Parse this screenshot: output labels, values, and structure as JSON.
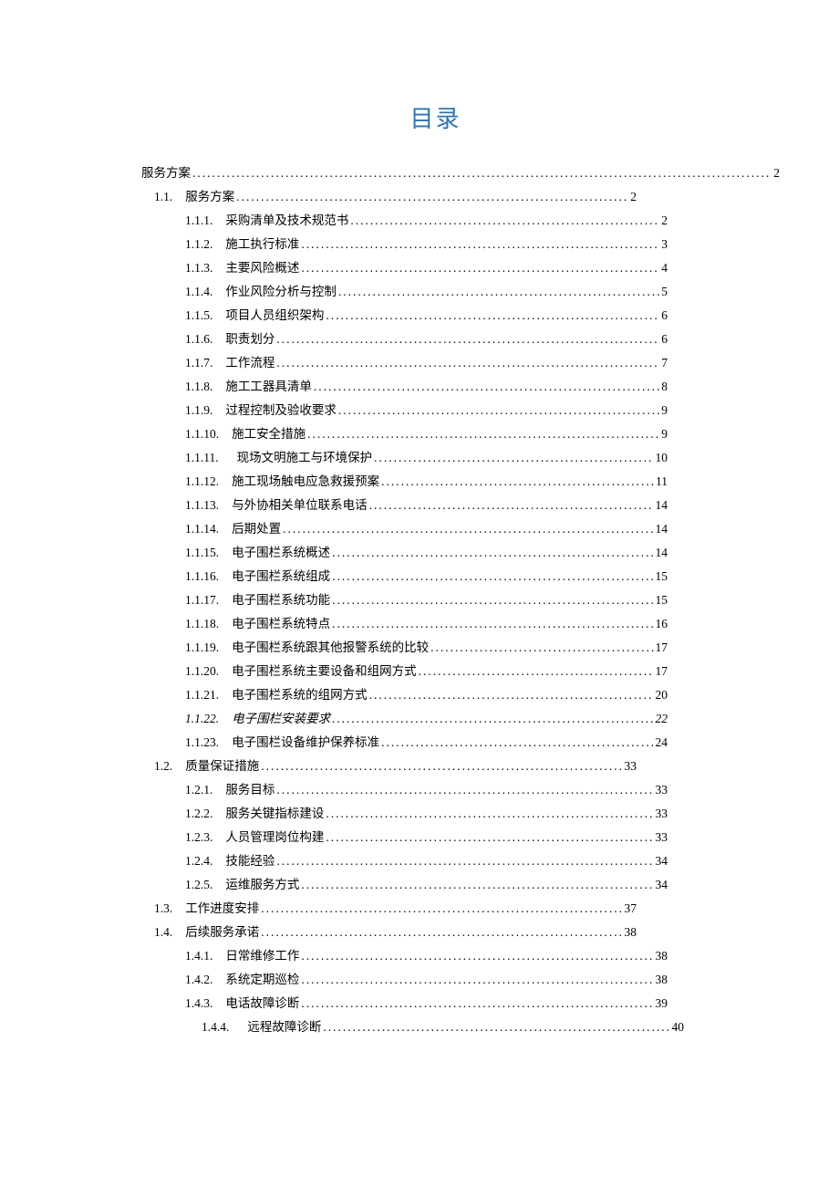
{
  "title": "目录",
  "toc": [
    {
      "indent": 0,
      "num": "",
      "text": "服务方案",
      "page": "2",
      "cls": "wide",
      "txtcls": "tight",
      "numhide": true
    },
    {
      "indent": 1,
      "num": "1.1.",
      "text": "服务方案",
      "page": "2",
      "cls": "short",
      "txtcls": ""
    },
    {
      "indent": 2,
      "num": "1.1.1.",
      "text": "采购清单及技术规范书",
      "page": "2",
      "cls": "short",
      "txtcls": ""
    },
    {
      "indent": 2,
      "num": "1.1.2.",
      "text": "施工执行标准",
      "page": "3",
      "cls": "short",
      "txtcls": ""
    },
    {
      "indent": 2,
      "num": "1.1.3.",
      "text": "主要风险概述",
      "page": "4",
      "cls": "short",
      "txtcls": ""
    },
    {
      "indent": 2,
      "num": "1.1.4.",
      "text": "作业风险分析与控制",
      "page": "5",
      "cls": "short",
      "txtcls": ""
    },
    {
      "indent": 2,
      "num": "1.1.5.",
      "text": "项目人员组织架构",
      "page": "6",
      "cls": "short",
      "txtcls": ""
    },
    {
      "indent": 2,
      "num": "1.1.6.",
      "text": "职责划分",
      "page": "6",
      "cls": "short",
      "txtcls": ""
    },
    {
      "indent": 2,
      "num": "1.1.7.",
      "text": "工作流程",
      "page": "7",
      "cls": "short",
      "txtcls": ""
    },
    {
      "indent": 2,
      "num": "1.1.8.",
      "text": "施工工器具清单",
      "page": "8",
      "cls": "short",
      "txtcls": ""
    },
    {
      "indent": 2,
      "num": "1.1.9.",
      "text": "过程控制及验收要求",
      "page": "9",
      "cls": "short",
      "txtcls": ""
    },
    {
      "indent": 2,
      "num": "1.1.10.",
      "text": "施工安全措施",
      "page": "9",
      "cls": "short",
      "txtcls": ""
    },
    {
      "indent": 2,
      "num": "1.1.11.",
      "text": "现场文明施工与环境保护",
      "page": "10",
      "cls": "short",
      "txtcls": "loose"
    },
    {
      "indent": 2,
      "num": "1.1.12.",
      "text": "施工现场触电应急救援预案",
      "page": "11",
      "cls": "short",
      "txtcls": ""
    },
    {
      "indent": 2,
      "num": "1.1.13.",
      "text": "与外协相关单位联系电话",
      "page": "14",
      "cls": "short",
      "txtcls": ""
    },
    {
      "indent": 2,
      "num": "1.1.14.",
      "text": "后期处置",
      "page": "14",
      "cls": "short",
      "txtcls": ""
    },
    {
      "indent": 2,
      "num": "1.1.15.",
      "text": "电子围栏系统概述",
      "page": "14",
      "cls": "short",
      "txtcls": ""
    },
    {
      "indent": 2,
      "num": "1.1.16.",
      "text": "电子围栏系统组成",
      "page": "15",
      "cls": "short",
      "txtcls": ""
    },
    {
      "indent": 2,
      "num": "1.1.17.",
      "text": "电子围栏系统功能",
      "page": "15",
      "cls": "short",
      "txtcls": ""
    },
    {
      "indent": 2,
      "num": "1.1.18.",
      "text": "电子围栏系统特点",
      "page": "16",
      "cls": "short",
      "txtcls": ""
    },
    {
      "indent": 2,
      "num": "1.1.19.",
      "text": "电子围栏系统跟其他报警系统的比较",
      "page": "17",
      "cls": "short",
      "txtcls": ""
    },
    {
      "indent": 2,
      "num": "1.1.20.",
      "text": "电子围栏系统主要设备和组网方式",
      "page": "17",
      "cls": "short",
      "txtcls": ""
    },
    {
      "indent": 2,
      "num": "1.1.21.",
      "text": "电子围栏系统的组网方式",
      "page": "20",
      "cls": "short",
      "txtcls": ""
    },
    {
      "indent": 2,
      "num": "1.1.22.",
      "text": "电子围栏安装要求",
      "page": "22",
      "cls": "short",
      "txtcls": "",
      "italic": true
    },
    {
      "indent": 2,
      "num": "1.1.23.",
      "text": "电子围栏设备维护保养标准",
      "page": "24",
      "cls": "short",
      "txtcls": ""
    },
    {
      "indent": 1,
      "num": "1.2.",
      "text": "质量保证措施",
      "page": "33",
      "cls": "short",
      "txtcls": ""
    },
    {
      "indent": 2,
      "num": "1.2.1.",
      "text": "服务目标",
      "page": "33",
      "cls": "short",
      "txtcls": ""
    },
    {
      "indent": 2,
      "num": "1.2.2.",
      "text": "服务关键指标建设",
      "page": "33",
      "cls": "short",
      "txtcls": ""
    },
    {
      "indent": 2,
      "num": "1.2.3.",
      "text": "人员管理岗位构建",
      "page": "33",
      "cls": "short",
      "txtcls": ""
    },
    {
      "indent": 2,
      "num": "1.2.4.",
      "text": "技能经验",
      "page": "34",
      "cls": "short",
      "txtcls": ""
    },
    {
      "indent": 2,
      "num": "1.2.5.",
      "text": "运维服务方式",
      "page": "34",
      "cls": "short",
      "txtcls": ""
    },
    {
      "indent": 1,
      "num": "1.3.",
      "text": "工作进度安排",
      "page": "37",
      "cls": "short",
      "txtcls": ""
    },
    {
      "indent": 1,
      "num": "1.4.",
      "text": "后续服务承诺",
      "page": "38",
      "cls": "short",
      "txtcls": ""
    },
    {
      "indent": 2,
      "num": "1.4.1.",
      "text": "日常维修工作",
      "page": "38",
      "cls": "short",
      "txtcls": ""
    },
    {
      "indent": 2,
      "num": "1.4.2.",
      "text": "系统定期巡检",
      "page": "38",
      "cls": "short",
      "txtcls": ""
    },
    {
      "indent": 2,
      "num": "1.4.3.",
      "text": "电话故障诊断",
      "page": "39",
      "cls": "short",
      "txtcls": ""
    },
    {
      "indent": 3,
      "num": "1.4.4.",
      "text": "远程故障诊断",
      "page": "40",
      "cls": "short",
      "txtcls": "loose"
    }
  ]
}
